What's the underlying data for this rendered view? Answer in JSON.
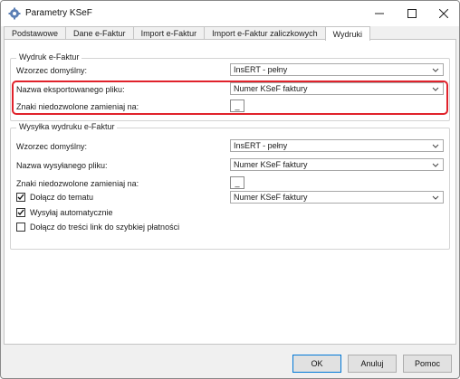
{
  "window": {
    "title": "Parametry KSeF"
  },
  "tabs": [
    {
      "label": "Podstawowe",
      "active": false
    },
    {
      "label": "Dane e-Faktur",
      "active": false
    },
    {
      "label": "Import e-Faktur",
      "active": false
    },
    {
      "label": "Import e-Faktur zaliczkowych",
      "active": false
    },
    {
      "label": "Wydruki",
      "active": true
    }
  ],
  "print_group": {
    "title": "Wydruk e-Faktur",
    "template_label": "Wzorzec domyślny:",
    "template_value": "InsERT - pełny",
    "file_name_label": "Nazwa eksportowanego pliku:",
    "file_name_value": "Numer KSeF faktury",
    "replace_label": "Znaki niedozwolone zamieniaj na:",
    "replace_value": "_"
  },
  "send_group": {
    "title": "Wysyłka wydruku e-Faktur",
    "template_label": "Wzorzec domyślny:",
    "template_value": "InsERT - pełny",
    "file_name_label": "Nazwa wysyłanego pliku:",
    "file_name_value": "Numer KSeF faktury",
    "replace_label": "Znaki niedozwolone zamieniaj na:",
    "replace_value": "_",
    "attach_to_subject_label": "Dołącz do tematu",
    "attach_to_subject_checked": true,
    "attach_to_subject_value": "Numer KSeF faktury",
    "send_automatically_label": "Wysyłaj automatycznie",
    "send_automatically_checked": true,
    "quick_payment_label": "Dołącz do treści link do szybkiej płatności",
    "quick_payment_checked": false
  },
  "buttons": {
    "ok": "OK",
    "cancel": "Anuluj",
    "help": "Pomoc"
  },
  "colors": {
    "highlight": "#e0222b",
    "accent": "#0078d7"
  }
}
